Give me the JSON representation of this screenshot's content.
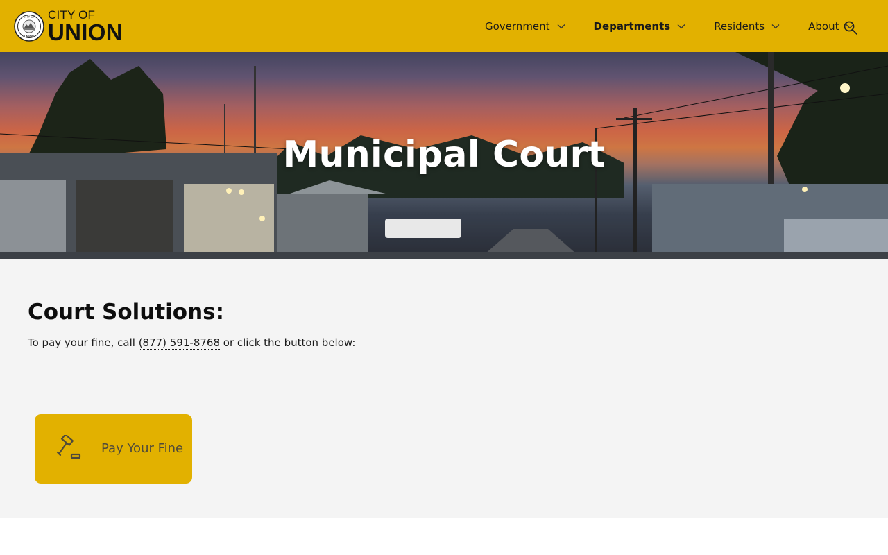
{
  "site": {
    "logo_small": "CITY OF",
    "logo_big": "UNION",
    "seal_text_top": "CITY OF",
    "seal_text_bottom": "UNION"
  },
  "nav": {
    "items": [
      {
        "label": "Government",
        "active": false
      },
      {
        "label": "Departments",
        "active": true
      },
      {
        "label": "Residents",
        "active": false
      },
      {
        "label": "About",
        "active": false
      }
    ],
    "search_icon": "search-icon"
  },
  "hero": {
    "title": "Municipal Court"
  },
  "main": {
    "heading": "Court Solutions:",
    "text_before": "To pay your fine, call ",
    "phone": "(877) 591-8768",
    "text_after": " or click the button below:",
    "pay_button": {
      "label": "Pay Your Fine",
      "icon": "gavel-icon"
    }
  },
  "colors": {
    "brand": "#e2b100",
    "content_bg": "#f4f4f4"
  }
}
